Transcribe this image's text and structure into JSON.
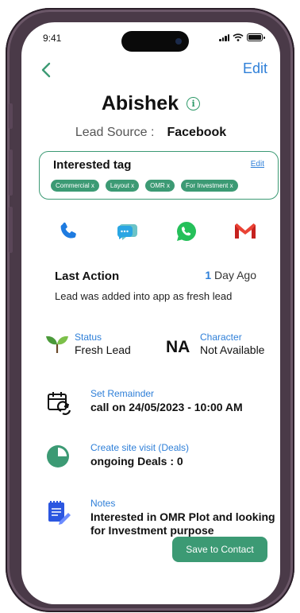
{
  "status_bar": {
    "time": "9:41"
  },
  "header": {
    "edit_label": "Edit"
  },
  "profile": {
    "name": "Abishek"
  },
  "lead_source": {
    "label": "Lead Source :",
    "value": "Facebook"
  },
  "interested_tag": {
    "title": "Interested tag",
    "edit_label": "Edit",
    "chips": [
      "Commercial x",
      "Layout x",
      "OMR x",
      "For Investment x"
    ]
  },
  "contact_icons": [
    "phone-icon",
    "chat-icon",
    "whatsapp-icon",
    "gmail-icon"
  ],
  "last_action": {
    "label": "Last Action",
    "days": "1",
    "days_suffix": " Day Ago",
    "text": "Lead was added into app as fresh lead"
  },
  "status": {
    "label": "Status",
    "value": "Fresh Lead"
  },
  "character": {
    "badge": "NA",
    "label": "Character",
    "value": "Not Available"
  },
  "reminder": {
    "label": "Set Remainder",
    "value": "call on 24/05/2023 - 10:00 AM"
  },
  "site_visit": {
    "label": "Create site visit (Deals)",
    "value": "ongoing  Deals : 0"
  },
  "notes": {
    "label": "Notes",
    "value": "Interested in OMR Plot and looking for Investment purpose"
  },
  "footer": {
    "save_label": "Save to Contact"
  },
  "colors": {
    "accent_green": "#3c9a74",
    "link_blue": "#2e7fd8",
    "frame": "#4a3a48"
  }
}
